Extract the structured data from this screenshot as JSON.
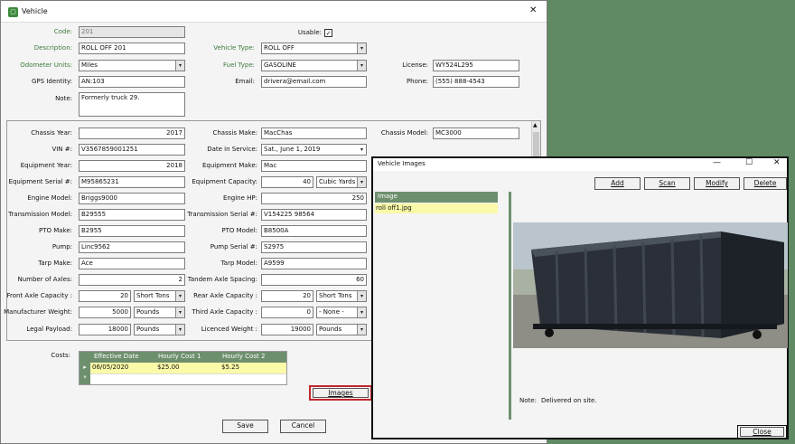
{
  "vehicle_window": {
    "title": "Vehicle",
    "close_glyph": "✕",
    "top": {
      "code_label": "Code:",
      "code_value": "201",
      "usable_label": "Usable:",
      "usable_checked": "✓",
      "description_label": "Description:",
      "description_value": "ROLL OFF 201",
      "vehicle_type_label": "Vehicle Type:",
      "vehicle_type_value": "ROLL OFF",
      "odometer_label": "Odometer Units:",
      "odometer_value": "Miles",
      "fuel_type_label": "Fuel Type:",
      "fuel_type_value": "GASOLINE",
      "license_label": "License:",
      "license_value": "WY524L295",
      "gps_label": "GPS Identity:",
      "gps_value": "AN:103",
      "email_label": "Email:",
      "email_value": "drivera@email.com",
      "phone_label": "Phone:",
      "phone_value": "(555) 888-4543",
      "note_label": "Note:",
      "note_value": "Formerly truck 29."
    },
    "details": {
      "chassis_year_label": "Chassis Year:",
      "chassis_year": "2017",
      "chassis_make_label": "Chassis Make:",
      "chassis_make": "MacChas",
      "chassis_model_label": "Chassis Model:",
      "chassis_model": "MC3000",
      "vin_label": "VIN #:",
      "vin": "V3567859001251",
      "date_service_label": "Date in Service:",
      "date_service": "Sat., June 1, 2019",
      "equip_year_label": "Equipment Year:",
      "equip_year": "2018",
      "equip_make_label": "Equipment Make:",
      "equip_make": "Mac",
      "equip_serial_label": "Equipment Serial #:",
      "equip_serial": "M95865231",
      "equip_capacity_label": "Equipment Capacity:",
      "equip_capacity": "40",
      "equip_capacity_unit": "Cubic Yards",
      "engine_model_label": "Engine Model:",
      "engine_model": "Briggs9000",
      "engine_hp_label": "Engine HP:",
      "engine_hp": "250",
      "trans_model_label": "Transmission Model:",
      "trans_model": "B29555",
      "trans_serial_label": "Transmission Serial #:",
      "trans_serial": "V154225 98564",
      "pto_make_label": "PTO Make:",
      "pto_make": "B2955",
      "pto_model_label": "PTO Model:",
      "pto_model": "B8500A",
      "pump_label": "Pump:",
      "pump": "Linc9562",
      "pump_serial_label": "Pump Serial #:",
      "pump_serial": "S2975",
      "tarp_make_label": "Tarp Make:",
      "tarp_make": "Ace",
      "tarp_model_label": "Tarp Model:",
      "tarp_model": "A9599",
      "axles_label": "Number of Axles:",
      "axles": "2",
      "tandem_label": "Tandem Axle Spacing:",
      "tandem": "60",
      "front_axle_label": "Front Axle Capacity :",
      "front_axle": "20",
      "front_axle_unit": "Short Tons",
      "rear_axle_label": "Rear Axle Capacity :",
      "rear_axle": "20",
      "rear_axle_unit": "Short Tons",
      "mfr_weight_label": "Manufacturer Weight:",
      "mfr_weight": "5000",
      "mfr_weight_unit": "Pounds",
      "third_axle_label": "Third Axle Capacity :",
      "third_axle": "0",
      "third_axle_unit": "- None -",
      "legal_payload_label": "Legal Payload:",
      "legal_payload": "18000",
      "legal_payload_unit": "Pounds",
      "licenced_weight_label": "Licenced Weight :",
      "licenced_weight": "19000",
      "licenced_weight_unit": "Pounds"
    },
    "costs": {
      "label": "Costs:",
      "headers": [
        "Effective Date",
        "Hourly Cost 1",
        "Hourly Cost 2"
      ],
      "row": {
        "indicator": "▸",
        "date": "06/05/2020",
        "cost1": "$25.00",
        "cost2": "$5.25"
      },
      "new_row_indicator": "*"
    },
    "images_button": "Images",
    "save_button": "Save",
    "cancel_button": "Cancel"
  },
  "images_window": {
    "title": "Vehicle Images",
    "add_button": "Add",
    "scan_button": "Scan",
    "modify_button": "Modify",
    "delete_button": "Delete",
    "list_header": "Image",
    "list_items": [
      "roll off1.jpg"
    ],
    "note_label": "Note:",
    "note_value": "Delivered on site.",
    "close_button": "Close"
  },
  "colors": {
    "background": "#5f8a63",
    "accent_green": "#3c7a3c",
    "selected_row": "#fafaa8",
    "focus_red": "#c0282d"
  }
}
